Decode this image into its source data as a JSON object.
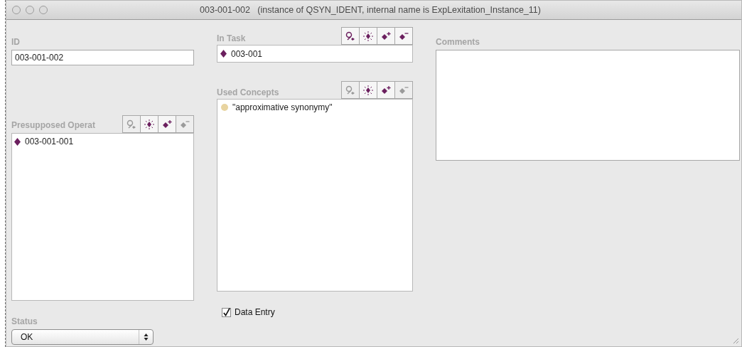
{
  "window": {
    "title": "003-001-002   (instance of QSYN_IDENT, internal name is ExpLexitation_Instance_11)"
  },
  "id_field": {
    "label": "ID",
    "value": "003-001-002"
  },
  "in_task": {
    "label": "In Task",
    "tools": [
      {
        "kind": "find",
        "disabled": false
      },
      {
        "kind": "browse",
        "disabled": false
      },
      {
        "kind": "add",
        "disabled": false
      },
      {
        "kind": "remove",
        "disabled": false
      }
    ],
    "items": [
      {
        "kind": "instance",
        "text": "003-001"
      }
    ]
  },
  "presupposed": {
    "label": "Presupposed Operat",
    "tools": [
      {
        "kind": "find",
        "disabled": true
      },
      {
        "kind": "browse",
        "disabled": false
      },
      {
        "kind": "add",
        "disabled": false
      },
      {
        "kind": "remove",
        "disabled": true
      }
    ],
    "items": [
      {
        "kind": "instance",
        "text": "003-001-001"
      }
    ]
  },
  "used_concepts": {
    "label": "Used Concepts",
    "tools": [
      {
        "kind": "find",
        "disabled": true
      },
      {
        "kind": "browse",
        "disabled": false
      },
      {
        "kind": "add",
        "disabled": false
      },
      {
        "kind": "remove",
        "disabled": true
      }
    ],
    "items": [
      {
        "kind": "class",
        "text": "\"approximative synonymy\""
      }
    ]
  },
  "comments": {
    "label": "Comments"
  },
  "status": {
    "label": "Status",
    "value": "OK"
  },
  "data_entry": {
    "label": "Data Entry",
    "checked": true
  }
}
